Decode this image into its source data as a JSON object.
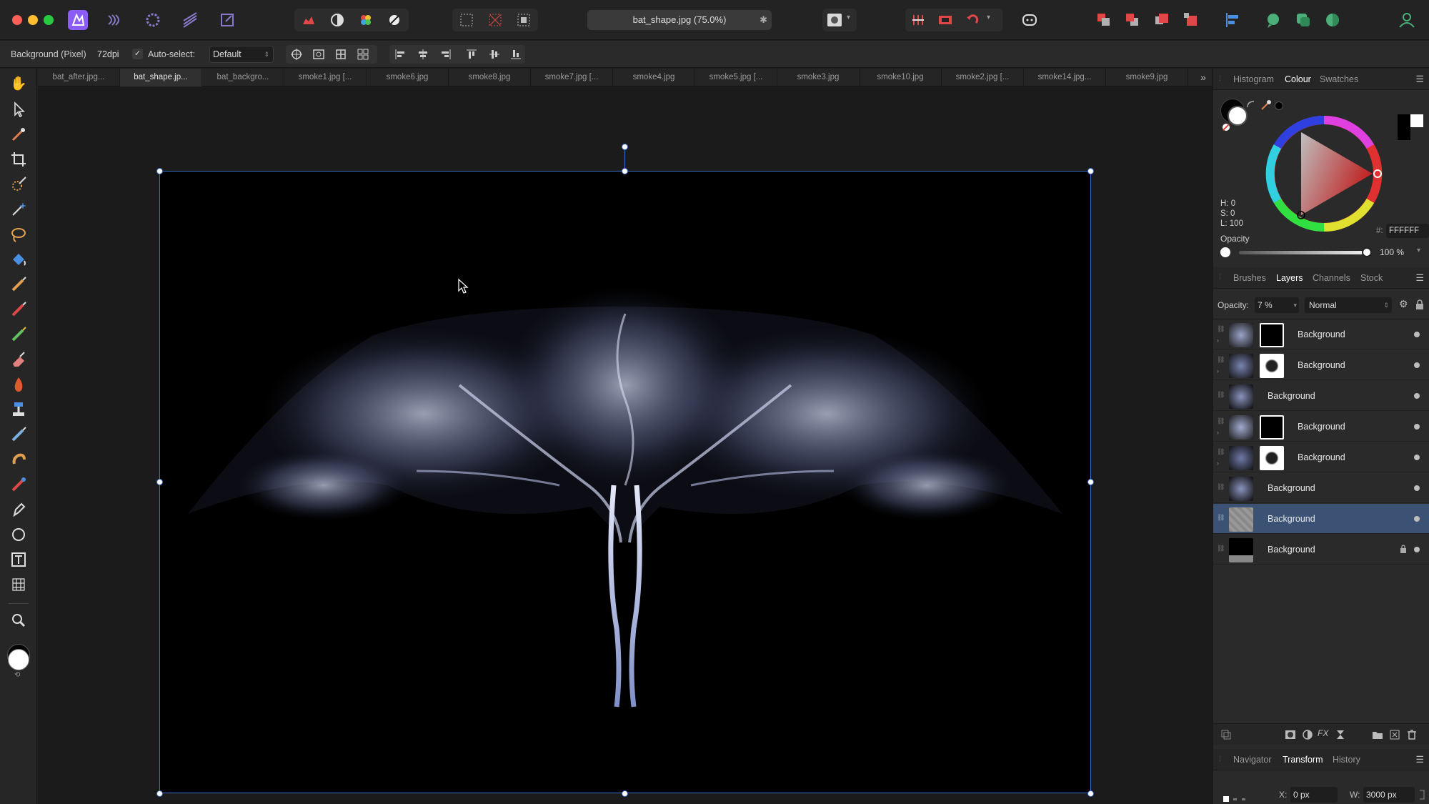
{
  "app": {
    "title": "bat_shape.jpg (75.0%)"
  },
  "context_bar": {
    "layer_type": "Background (Pixel)",
    "dpi": "72dpi",
    "auto_select_label": "Auto-select:",
    "auto_select_value": "Default"
  },
  "doc_tabs": [
    "bat_after.jpg...",
    "bat_shape.jp...",
    "bat_backgro...",
    "smoke1.jpg [...",
    "smoke6.jpg",
    "smoke8.jpg",
    "smoke7.jpg [...",
    "smoke4.jpg",
    "smoke5.jpg [...",
    "smoke3.jpg",
    "smoke10.jpg",
    "smoke2.jpg [...",
    "smoke14.jpg...",
    "smoke9.jpg"
  ],
  "colour_panel": {
    "tabs": [
      "Histogram",
      "Colour",
      "Swatches"
    ],
    "h": "H: 0",
    "s": "S: 0",
    "l": "L: 100",
    "hex_label": "#:",
    "hex": "FFFFFF",
    "opacity_label": "Opacity",
    "opacity_value": "100 %"
  },
  "layers_panel": {
    "tabs": [
      "Brushes",
      "Layers",
      "Channels",
      "Stock"
    ],
    "opacity_label": "Opacity:",
    "opacity_value": "7 %",
    "blend_mode": "Normal",
    "layers": [
      {
        "name": "Background"
      },
      {
        "name": "Background"
      },
      {
        "name": "Background"
      },
      {
        "name": "Background"
      },
      {
        "name": "Background"
      },
      {
        "name": "Background"
      },
      {
        "name": "Background"
      },
      {
        "name": "Background"
      }
    ]
  },
  "transform_panel": {
    "tabs": [
      "Navigator",
      "Transform",
      "History"
    ],
    "x_label": "X:",
    "x_value": "0 px",
    "w_label": "W:",
    "w_value": "3000 px"
  },
  "colors": {
    "selection": "#3b5275",
    "accent": "#3c6cc9"
  }
}
